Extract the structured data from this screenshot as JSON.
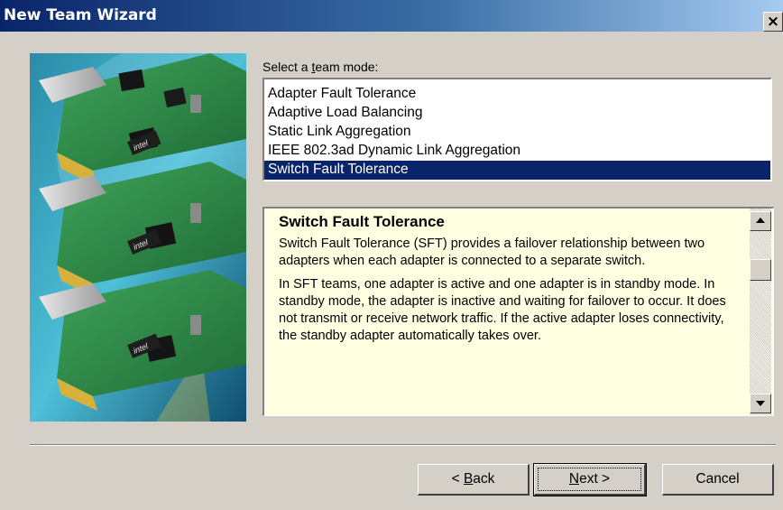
{
  "window": {
    "title": "New Team Wizard",
    "close_glyph": "×"
  },
  "team_mode": {
    "label_prefix": "Select a ",
    "label_accel": "t",
    "label_suffix": "eam mode:",
    "options": [
      "Adapter Fault Tolerance",
      "Adaptive Load Balancing",
      "Static Link Aggregation",
      "IEEE 802.3ad Dynamic Link Aggregation",
      "Switch Fault Tolerance"
    ],
    "selected": "Switch Fault Tolerance"
  },
  "description": {
    "title": "Switch Fault Tolerance",
    "paragraphs": [
      "Switch Fault Tolerance (SFT) provides a failover relationship between two adapters when each adapter is connected to a separate switch.",
      "In SFT teams, one adapter is active and one adapter is in standby mode. In standby mode, the adapter is inactive and waiting for failover to occur. It does not transmit or receive network traffic. If the active adapter loses connectivity, the standby adapter automatically takes over."
    ]
  },
  "buttons": {
    "back_prefix": "< ",
    "back_accel": "B",
    "back_suffix": "ack",
    "next_accel": "N",
    "next_suffix": "ext >",
    "cancel": "Cancel"
  },
  "artwork": {
    "chip_text": "intel"
  },
  "colors": {
    "title_gradient_start": "#0a246a",
    "selection": "#0a246a",
    "tooltip_background": "#ffffe1",
    "dialog_face": "#d4d0c8"
  }
}
